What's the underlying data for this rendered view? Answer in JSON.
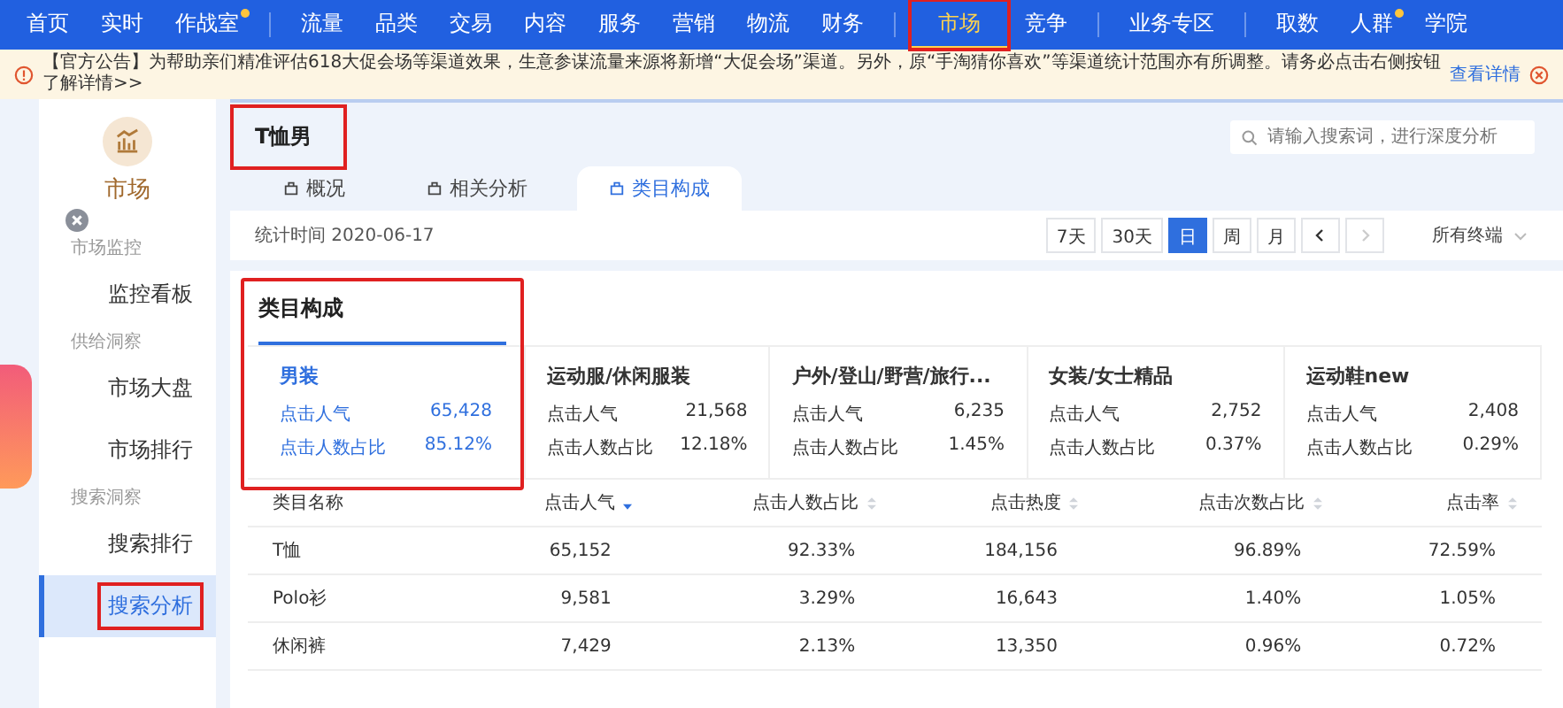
{
  "top_nav": {
    "groups": [
      {
        "items": [
          {
            "label": "首页",
            "dot": false,
            "selected": false,
            "highlighted": false
          },
          {
            "label": "实时",
            "dot": false,
            "selected": false,
            "highlighted": false
          },
          {
            "label": "作战室",
            "dot": true,
            "selected": false,
            "highlighted": false
          }
        ]
      },
      {
        "items": [
          {
            "label": "流量",
            "dot": false,
            "selected": false,
            "highlighted": false
          },
          {
            "label": "品类",
            "dot": false,
            "selected": false,
            "highlighted": false
          },
          {
            "label": "交易",
            "dot": false,
            "selected": false,
            "highlighted": false
          },
          {
            "label": "内容",
            "dot": false,
            "selected": false,
            "highlighted": false
          },
          {
            "label": "服务",
            "dot": false,
            "selected": false,
            "highlighted": false
          },
          {
            "label": "营销",
            "dot": false,
            "selected": false,
            "highlighted": false
          },
          {
            "label": "物流",
            "dot": false,
            "selected": false,
            "highlighted": false
          },
          {
            "label": "财务",
            "dot": false,
            "selected": false,
            "highlighted": false
          }
        ]
      },
      {
        "items": [
          {
            "label": "市场",
            "dot": false,
            "selected": true,
            "highlighted": true
          },
          {
            "label": "竞争",
            "dot": false,
            "selected": false,
            "highlighted": false
          }
        ]
      },
      {
        "items": [
          {
            "label": "业务专区",
            "dot": false,
            "selected": false,
            "highlighted": false
          }
        ]
      },
      {
        "items": [
          {
            "label": "取数",
            "dot": false,
            "selected": false,
            "highlighted": false
          },
          {
            "label": "人群",
            "dot": true,
            "selected": false,
            "highlighted": false
          },
          {
            "label": "学院",
            "dot": false,
            "selected": false,
            "highlighted": false
          }
        ]
      }
    ]
  },
  "notice": {
    "text": "【官方公告】为帮助亲们精准评估618大促会场等渠道效果，生意参谋流量来源将新增“大促会场”渠道。另外，原“手淘猜你喜欢”等渠道统计范围亦有所调整。请务必点击右侧按钮了解详情>>",
    "link": "查看详情"
  },
  "sidebar": {
    "title": "市场",
    "groups": [
      {
        "label": "市场监控",
        "items": [
          {
            "label": "监控看板",
            "selected": false,
            "highlighted": false
          }
        ]
      },
      {
        "label": "供给洞察",
        "items": [
          {
            "label": "市场大盘",
            "selected": false,
            "highlighted": false
          },
          {
            "label": "市场排行",
            "selected": false,
            "highlighted": false
          }
        ]
      },
      {
        "label": "搜索洞察",
        "items": [
          {
            "label": "搜索排行",
            "selected": false,
            "highlighted": false
          },
          {
            "label": "搜索分析",
            "selected": true,
            "highlighted": true
          }
        ]
      }
    ]
  },
  "header": {
    "title": "T恤男",
    "title_highlighted": true,
    "search": {
      "placeholder": "请输入搜索词，进行深度分析"
    }
  },
  "tabs": [
    {
      "label": "概况",
      "selected": false
    },
    {
      "label": "相关分析",
      "selected": false
    },
    {
      "label": "类目构成",
      "selected": true
    }
  ],
  "date_bar": {
    "label": "统计时间 2020-06-17",
    "ranges": [
      {
        "label": "7天",
        "selected": false
      },
      {
        "label": "30天",
        "selected": false
      },
      {
        "label": "日",
        "selected": true
      },
      {
        "label": "周",
        "selected": false
      },
      {
        "label": "月",
        "selected": false
      }
    ],
    "prev_disabled": false,
    "next_disabled": true,
    "terminal": "所有终端"
  },
  "composition": {
    "title": "类目构成",
    "highlighted": true,
    "categories": [
      {
        "name": "男装",
        "selected": true,
        "metrics": [
          {
            "label": "点击人气",
            "value": "65,428"
          },
          {
            "label": "点击人数占比",
            "value": "85.12%"
          }
        ]
      },
      {
        "name": "运动服/休闲服装",
        "selected": false,
        "metrics": [
          {
            "label": "点击人气",
            "value": "21,568"
          },
          {
            "label": "点击人数占比",
            "value": "12.18%"
          }
        ]
      },
      {
        "name": "户外/登山/野营/旅行...",
        "selected": false,
        "metrics": [
          {
            "label": "点击人气",
            "value": "6,235"
          },
          {
            "label": "点击人数占比",
            "value": "1.45%"
          }
        ]
      },
      {
        "name": "女装/女士精品",
        "selected": false,
        "metrics": [
          {
            "label": "点击人气",
            "value": "2,752"
          },
          {
            "label": "点击人数占比",
            "value": "0.37%"
          }
        ]
      },
      {
        "name": "运动鞋new",
        "selected": false,
        "metrics": [
          {
            "label": "点击人气",
            "value": "2,408"
          },
          {
            "label": "点击人数占比",
            "value": "0.29%"
          }
        ]
      }
    ],
    "table": {
      "columns": [
        {
          "label": "类目名称"
        },
        {
          "label": "点击人气",
          "sortable": true,
          "sorted": true
        },
        {
          "label": "点击人数占比",
          "sortable": true,
          "sorted": false
        },
        {
          "label": "点击热度",
          "sortable": true,
          "sorted": false
        },
        {
          "label": "点击次数占比",
          "sortable": true,
          "sorted": false
        },
        {
          "label": "点击率",
          "sortable": true,
          "sorted": false
        }
      ],
      "rows": [
        [
          "T恤",
          "65,152",
          "92.33%",
          "184,156",
          "96.89%",
          "72.59%"
        ],
        [
          "Polo衫",
          "9,581",
          "3.29%",
          "16,643",
          "1.40%",
          "1.05%"
        ],
        [
          "休闲裤",
          "7,429",
          "2.13%",
          "13,350",
          "0.96%",
          "0.72%"
        ]
      ]
    }
  }
}
